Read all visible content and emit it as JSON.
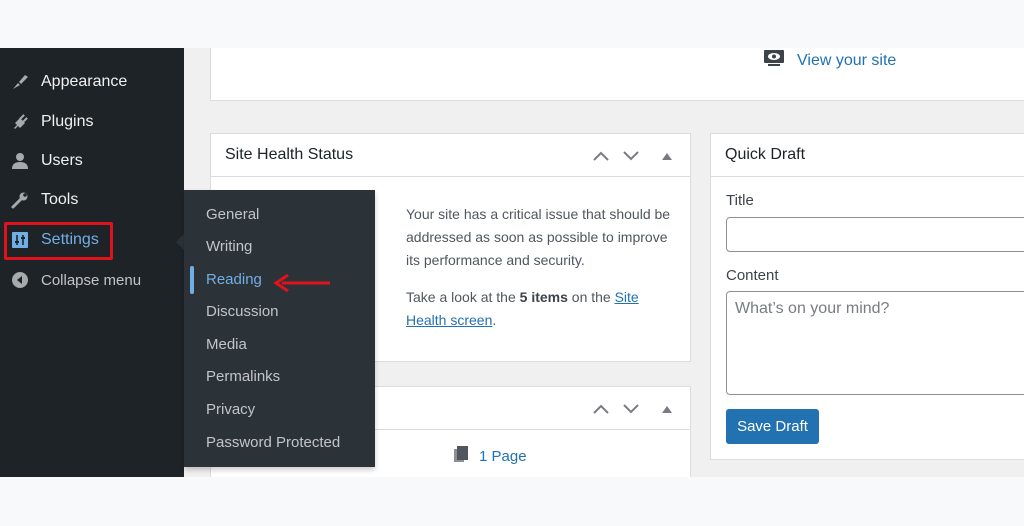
{
  "sidebar": {
    "items": [
      {
        "label": "Appearance",
        "icon": "paintbrush-icon"
      },
      {
        "label": "Plugins",
        "icon": "plugin-icon"
      },
      {
        "label": "Users",
        "icon": "user-icon"
      },
      {
        "label": "Tools",
        "icon": "wrench-icon"
      },
      {
        "label": "Settings",
        "icon": "settings-icon",
        "active": true,
        "highlighted": true
      },
      {
        "label": "Collapse menu",
        "icon": "collapse-icon"
      }
    ],
    "highlight_color": "#e0121b"
  },
  "settings_submenu": {
    "items": [
      "General",
      "Writing",
      "Reading",
      "Discussion",
      "Media",
      "Permalinks",
      "Privacy",
      "Password Protected"
    ],
    "current": "Reading",
    "annotation": "red-arrow-pointing-left"
  },
  "top_card": {
    "view_site_label": "View your site"
  },
  "site_health": {
    "title": "Site Health Status",
    "message": "Your site has a critical issue that should be addressed as soon as possible to improve its performance and security.",
    "take_look_prefix": "Take a look at the ",
    "items_count": "5 items",
    "take_look_middle": " on the ",
    "link_text": "Site Health screen",
    "suffix": "."
  },
  "at_a_glance": {
    "page_count_label": "1 Page"
  },
  "quick_draft": {
    "title": "Quick Draft",
    "title_label": "Title",
    "title_value": "",
    "content_label": "Content",
    "content_placeholder": "What’s on your mind?",
    "save_label": "Save Draft"
  },
  "colors": {
    "sidebar_bg": "#1d2327",
    "submenu_bg": "#2c3338",
    "accent": "#2271b1",
    "active_link": "#72aee6"
  }
}
